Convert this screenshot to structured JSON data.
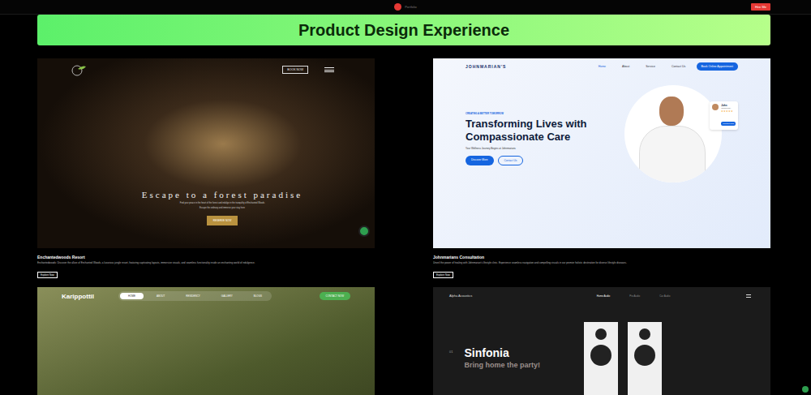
{
  "topbar": {
    "brand": "Portfolio",
    "button": "Hire Me"
  },
  "banner": {
    "title": "Product Design Experience"
  },
  "projects": [
    {
      "kind": "resort",
      "title": "Enchantedwoods Resort",
      "description": "Enchantedwoods: Discover the allure of Enchanted Woods, a luxurious jungle resort, featuring captivating layouts, immersive visuals, and seamless functionality inside an enchanting world of indulgence.",
      "button": "Explore Now",
      "site": {
        "nav_button": "BOOK NOW",
        "heading": "Escape to a forest paradise",
        "subtext": "Find your peace in the heart of the forest and indulge in the tranquility of Enchanted Woods",
        "subtext2": "Escape the ordinary and immerse your stay here",
        "cta": "RESERVE NOW"
      }
    },
    {
      "kind": "clinic",
      "title": "Johnmarians Consultation",
      "description": "Unveil the power of healing with Johnmarian's lifestyle clinic. Experience seamless navigation and compelling visuals in our premier holistic destination for diverse lifestyle diseases.",
      "button": "Explore Now",
      "site": {
        "brand": "JOHNMARIAN'S",
        "nav": [
          {
            "label": "Home",
            "selected": true
          },
          {
            "label": "About",
            "selected": false
          },
          {
            "label": "Service",
            "selected": false
          },
          {
            "label": "Contact Us",
            "selected": false
          }
        ],
        "nav_button": "Book Online Appointment",
        "tag": "CREATING A BETTER TOMORROW",
        "heading": "Transforming Lives with Compassionate Care",
        "subtext": "Your Wellness Journey Begins at Johnmarians",
        "primary": "Discover More",
        "secondary": "Contact Us",
        "badge": {
          "name": "John",
          "role": "Cardiology",
          "stars": 5,
          "button": "Contact Now"
        }
      }
    },
    {
      "kind": "residency",
      "title": "Karippottil",
      "description": "",
      "button": "",
      "site": {
        "brand": "Karippottil",
        "nav": [
          {
            "label": "HOME",
            "selected": true
          },
          {
            "label": "ABOUT",
            "selected": false
          },
          {
            "label": "RESIDENCY",
            "selected": false
          },
          {
            "label": "GALLERY",
            "selected": false
          },
          {
            "label": "BLOGS",
            "selected": false
          }
        ],
        "nav_button": "CONTACT NOW"
      }
    },
    {
      "kind": "audio",
      "title": "Sinfonia",
      "description": "",
      "button": "",
      "site": {
        "brand": "Alpha Acoustics",
        "nav": [
          {
            "label": "Home Audio",
            "selected": true
          },
          {
            "label": "Pro Audio",
            "selected": false
          },
          {
            "label": "Car Audio",
            "selected": false
          }
        ],
        "index": "01",
        "heading": "Sinfonia",
        "subtext": "Bring home the party!"
      }
    }
  ]
}
